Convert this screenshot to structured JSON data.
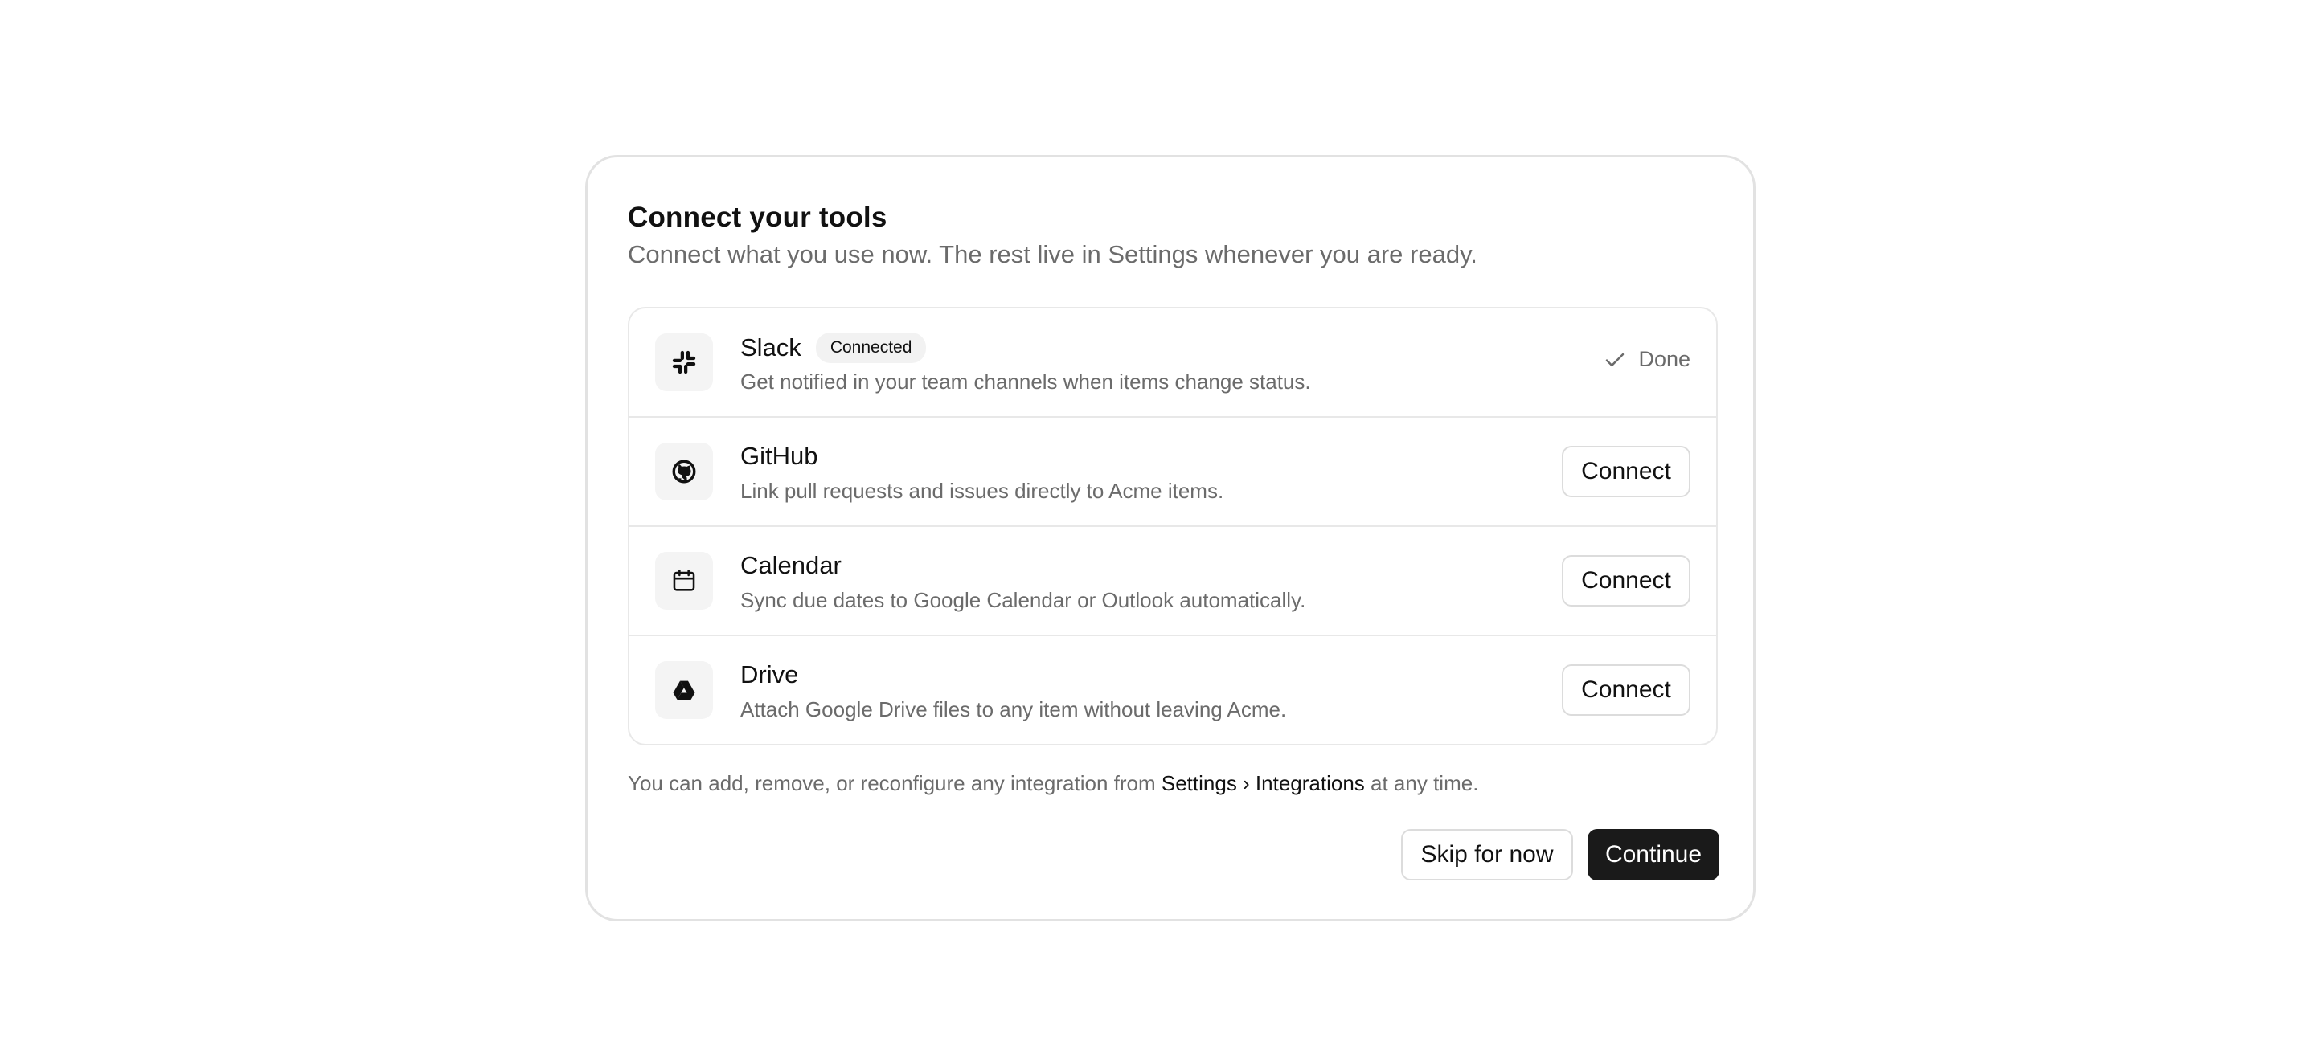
{
  "dialog": {
    "title": "Connect your tools",
    "subtitle": "Connect what you use now. The rest live in Settings whenever you are ready."
  },
  "integrations": [
    {
      "name": "Slack",
      "badge": "Connected",
      "description": "Get notified in your team channels when items change status.",
      "status_label": "Done",
      "icon": "slack-icon"
    },
    {
      "name": "GitHub",
      "description": "Link pull requests and issues directly to Acme items.",
      "action_label": "Connect",
      "icon": "github-icon"
    },
    {
      "name": "Calendar",
      "description": "Sync due dates to Google Calendar or Outlook automatically.",
      "action_label": "Connect",
      "icon": "calendar-icon"
    },
    {
      "name": "Drive",
      "description": "Attach Google Drive files to any item without leaving Acme.",
      "action_label": "Connect",
      "icon": "drive-icon"
    }
  ],
  "footnote": {
    "prefix": "You can add, remove, or reconfigure any integration from ",
    "link": "Settings › Integrations",
    "suffix": " at any time."
  },
  "actions": {
    "skip_label": "Skip for now",
    "continue_label": "Continue"
  },
  "colors": {
    "primary": "#1a1a1a",
    "muted_text": "#6b6b6b",
    "border": "#e2e2e2"
  }
}
